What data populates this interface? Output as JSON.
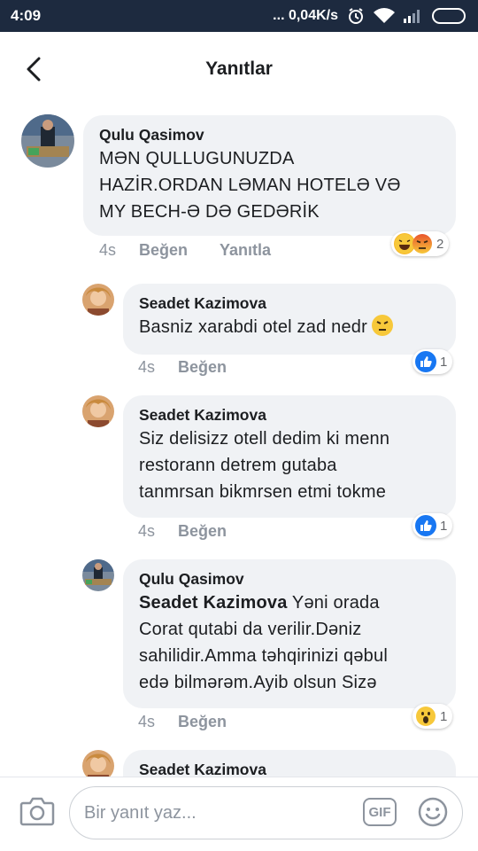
{
  "status_bar": {
    "time": "4:09",
    "network_speed": "... 0,04K/s"
  },
  "header": {
    "title": "Yanıtlar"
  },
  "comments": [
    {
      "author": "Qulu Qasimov",
      "text": "MƏN QULLUGUNUZDA HAZİR.ORDAN LƏMAN HOTELƏ VƏ MY BECH-Ə DƏ GEDƏRİK",
      "text_lines": [
        "MƏN QULLUGUNUZDA",
        "HAZİR.ORDAN LƏMAN HOTELƏ VƏ",
        "MY BECH-Ə DƏ GEDƏRİK"
      ],
      "time": "4s",
      "like_label": "Beğen",
      "reply_label": "Yanıtla",
      "reactions": [
        "haha",
        "angry"
      ],
      "reaction_count": "2"
    },
    {
      "author": "Seadet Kazimova",
      "text": "Basniz xarabdi otel zad nedr",
      "time": "4s",
      "like_label": "Beğen",
      "reactions": [
        "like"
      ],
      "reaction_count": "1"
    },
    {
      "author": "Seadet Kazimova",
      "text_lines": [
        "Siz delisizz otell dedim ki menn",
        "restorann detrem gutaba",
        "tanmrsan bikmrsen etmi tokme"
      ],
      "time": "4s",
      "like_label": "Beğen",
      "reactions": [
        "like"
      ],
      "reaction_count": "1"
    },
    {
      "author": "Qulu Qasimov",
      "mention": "Seadet Kazimova",
      "text_first_line_rest": "Yəni orada",
      "text_lines": [
        "Corat qutabi da verilir.Dəniz",
        "sahilidir.Amma təhqirinizi qəbul",
        "edə bilmərəm.Ayib olsun Sizə"
      ],
      "time": "4s",
      "like_label": "Beğen",
      "reactions": [
        "wow"
      ],
      "reaction_count": "1"
    },
    {
      "author": "Seadet Kazimova"
    }
  ],
  "composer": {
    "placeholder": "Bir yanıt yaz...",
    "gif_label": "GIF"
  },
  "colors": {
    "status_bar": "#1d2a3f",
    "bubble": "#f0f2f5",
    "meta_text": "#8d949e",
    "like_blue": "#1877f2"
  }
}
